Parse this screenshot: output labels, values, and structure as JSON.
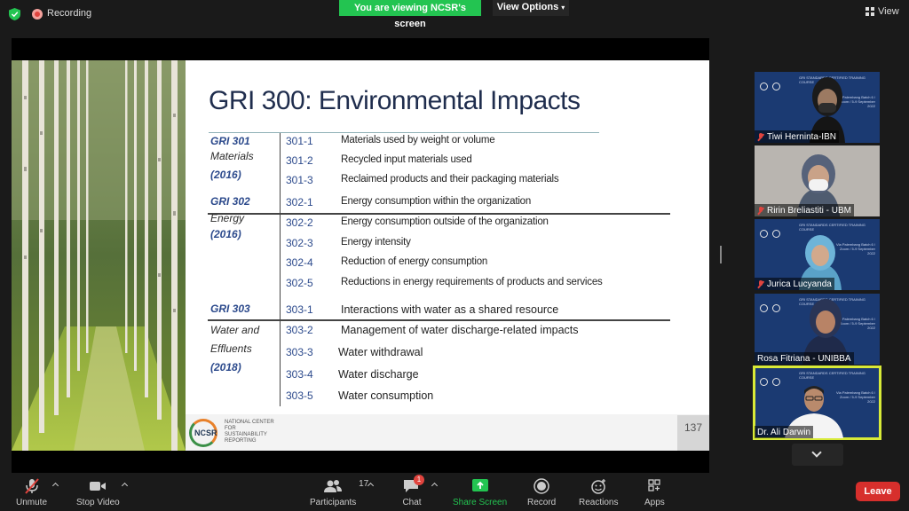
{
  "topbar": {
    "recording_label": "Recording",
    "viewing_banner": "You are viewing NCSR's screen",
    "view_options_label": "View Options",
    "view_label": "View"
  },
  "slide": {
    "title": "GRI 300: Environmental Impacts",
    "page_number": "137",
    "logo_text": "NCSR",
    "logo_subtext": "NATIONAL CENTER FOR SUSTAINABILITY REPORTING",
    "groups": [
      {
        "code": "GRI 301",
        "name": "Materials",
        "year": "(2016)",
        "items": [
          {
            "code": "301-1",
            "desc": "Materials used by weight or  volume"
          },
          {
            "code": "301-2",
            "desc": "Recycled input materials used"
          },
          {
            "code": "301-3",
            "desc": "Reclaimed products and their packaging materials"
          }
        ]
      },
      {
        "code": "GRI 302",
        "name": "Energy",
        "year": "(2016)",
        "items": [
          {
            "code": "302-1",
            "desc": "Energy consumption within the organization"
          },
          {
            "code": "302-2",
            "desc": "Energy consumption outside of the organization"
          },
          {
            "code": "302-3",
            "desc": "Energy intensity"
          },
          {
            "code": "302-4",
            "desc": "Reduction of energy consumption"
          },
          {
            "code": "302-5",
            "desc": "Reductions in energy requirements of products and services"
          }
        ]
      },
      {
        "code": "GRI 303",
        "name": "Water and",
        "name2": "Effluents",
        "year": "(2018)",
        "items": [
          {
            "code": "303-1",
            "desc": "Interactions with water as a shared resource"
          },
          {
            "code": "303-2",
            "desc": "Management of water discharge-related impacts"
          },
          {
            "code": "303-3",
            "desc": "Water withdrawal"
          },
          {
            "code": "303-4",
            "desc": "Water discharge"
          },
          {
            "code": "303-5",
            "desc": "Water consumption"
          }
        ]
      }
    ]
  },
  "participants": {
    "tile_header": "GRI STANDARDS CERTIFIED TRAINING COURSE",
    "tile_info": "Via Palembang Batch 6 / Zoom / 5-9 September 2022",
    "list": [
      {
        "name": "Tiwi Herninta-IBN",
        "muted": true
      },
      {
        "name": "Ririn Breliastiti - UBM",
        "muted": true
      },
      {
        "name": "Jurica Lucyanda",
        "muted": true
      },
      {
        "name": "Rosa Fitriana - UNIBBA",
        "muted": false
      },
      {
        "name": "Dr. Ali Darwin",
        "muted": false
      }
    ]
  },
  "toolbar": {
    "unmute": "Unmute",
    "stop_video": "Stop Video",
    "participants": "Participants",
    "participants_count": "17",
    "chat": "Chat",
    "chat_badge": "1",
    "share_screen": "Share Screen",
    "record": "Record",
    "reactions": "Reactions",
    "apps": "Apps",
    "leave": "Leave"
  },
  "colors": {
    "share_green": "#23c451",
    "leave_red": "#d72f2c",
    "active_speaker": "#d8ea38",
    "slide_title": "#1f2d4d"
  }
}
